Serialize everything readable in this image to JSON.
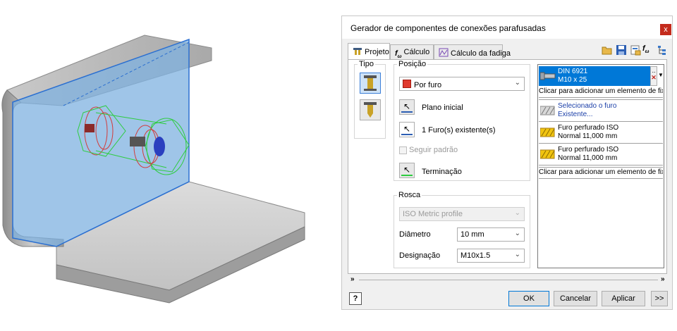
{
  "dialog": {
    "title": "Gerador de componentes de conexões parafusadas",
    "close_label": "x",
    "tabs": [
      {
        "label": "Projeto"
      },
      {
        "label": "Cálculo"
      },
      {
        "label": "Cálculo da fadiga"
      }
    ]
  },
  "tipo": {
    "legend": "Tipo"
  },
  "posicao": {
    "legend": "Posição",
    "placement_value": "Por furo",
    "plano_inicial": "Plano inicial",
    "furos_existentes": "1 Furo(s) existente(s)",
    "seguir_padrao": "Seguir padrão",
    "terminacao": "Terminação"
  },
  "rosca": {
    "legend": "Rosca",
    "thread_value": "ISO Metric profile",
    "diametro_label": "Diâmetro",
    "diametro_value": "10 mm",
    "designacao_label": "Designação",
    "designacao_value": "M10x1.5"
  },
  "fasteners": {
    "bolt_line1": "DIN 6921",
    "bolt_line2": "M10 x 25",
    "more_label": "..",
    "add_top": "Clicar para adicionar um elemento de fixa...",
    "selected_line1": "Selecionado o furo",
    "selected_line2": "Existente...",
    "hole1_line1": "Furo perfurado ISO",
    "hole1_line2": "Normal 11,000 mm",
    "hole2_line1": "Furo perfurado ISO",
    "hole2_line2": "Normal 11,000 mm",
    "add_bottom": "Clicar para adicionar um elemento de fixa..."
  },
  "expand": {
    "left": "»",
    "right": "»"
  },
  "buttons": {
    "help": "?",
    "ok": "OK",
    "cancel": "Cancelar",
    "apply": "Aplicar",
    "more": ">>"
  },
  "colors": {
    "selection": "#0078d7",
    "panel_blue": "#7fb2e0",
    "close_red": "#c42b1c"
  }
}
